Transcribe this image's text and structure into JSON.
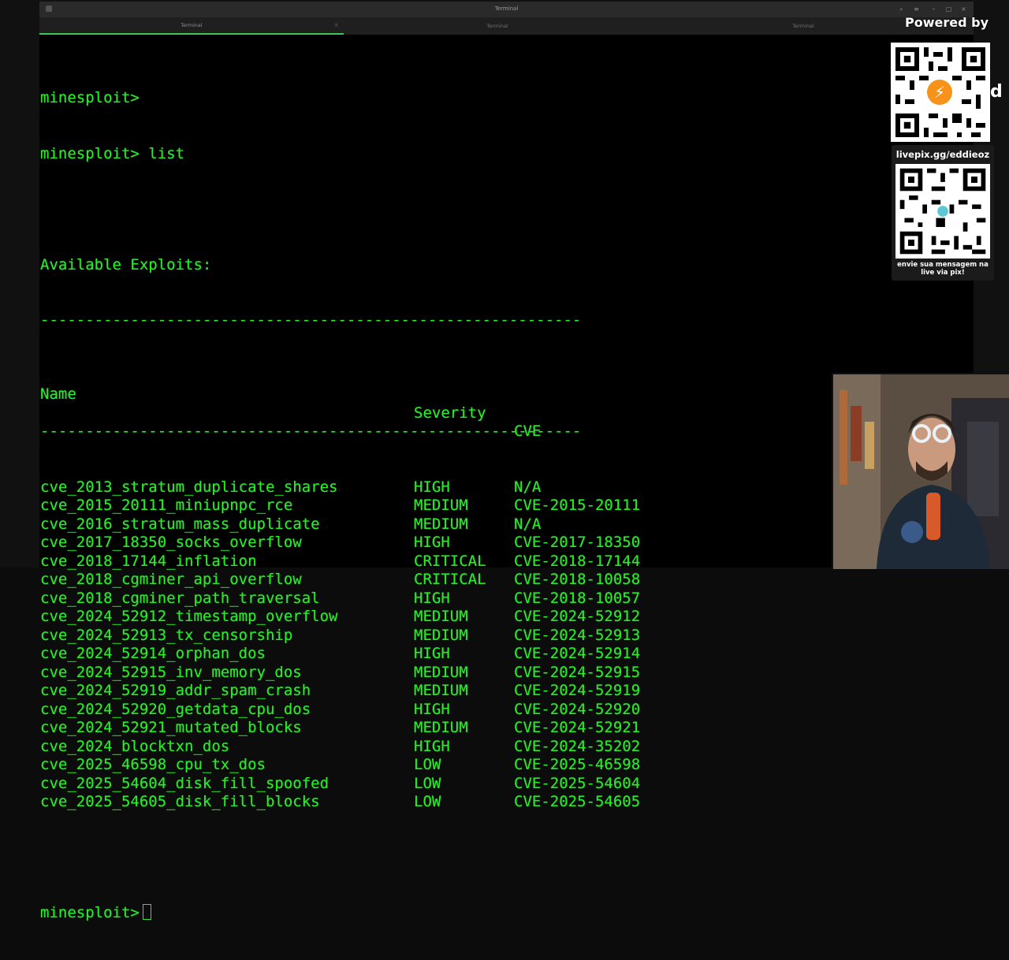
{
  "window": {
    "title": "Terminal",
    "tabs": [
      {
        "label": "Terminal",
        "active": true
      },
      {
        "label": "Terminal",
        "active": false
      },
      {
        "label": "Terminal",
        "active": false
      }
    ]
  },
  "terminal": {
    "prompt_line_1": "minesploit>",
    "prompt_line_2": "minesploit> list",
    "heading": "Available Exploits:",
    "separator": "------------------------------------------------------------",
    "columns": {
      "name": "Name",
      "severity": "Severity",
      "cve": "CVE"
    },
    "exploits": [
      {
        "name": "cve_2013_stratum_duplicate_shares",
        "severity": "HIGH",
        "cve": "N/A"
      },
      {
        "name": "cve_2015_20111_miniupnpc_rce",
        "severity": "MEDIUM",
        "cve": "CVE-2015-20111"
      },
      {
        "name": "cve_2016_stratum_mass_duplicate",
        "severity": "MEDIUM",
        "cve": "N/A"
      },
      {
        "name": "cve_2017_18350_socks_overflow",
        "severity": "HIGH",
        "cve": "CVE-2017-18350"
      },
      {
        "name": "cve_2018_17144_inflation",
        "severity": "CRITICAL",
        "cve": "CVE-2018-17144"
      },
      {
        "name": "cve_2018_cgminer_api_overflow",
        "severity": "CRITICAL",
        "cve": "CVE-2018-10058"
      },
      {
        "name": "cve_2018_cgminer_path_traversal",
        "severity": "HIGH",
        "cve": "CVE-2018-10057"
      },
      {
        "name": "cve_2024_52912_timestamp_overflow",
        "severity": "MEDIUM",
        "cve": "CVE-2024-52912"
      },
      {
        "name": "cve_2024_52913_tx_censorship",
        "severity": "MEDIUM",
        "cve": "CVE-2024-52913"
      },
      {
        "name": "cve_2024_52914_orphan_dos",
        "severity": "HIGH",
        "cve": "CVE-2024-52914"
      },
      {
        "name": "cve_2024_52915_inv_memory_dos",
        "severity": "MEDIUM",
        "cve": "CVE-2024-52915"
      },
      {
        "name": "cve_2024_52919_addr_spam_crash",
        "severity": "MEDIUM",
        "cve": "CVE-2024-52919"
      },
      {
        "name": "cve_2024_52920_getdata_cpu_dos",
        "severity": "HIGH",
        "cve": "CVE-2024-52920"
      },
      {
        "name": "cve_2024_52921_mutated_blocks",
        "severity": "MEDIUM",
        "cve": "CVE-2024-52921"
      },
      {
        "name": "cve_2024_blocktxn_dos",
        "severity": "HIGH",
        "cve": "CVE-2024-35202"
      },
      {
        "name": "cve_2025_46598_cpu_tx_dos",
        "severity": "LOW",
        "cve": "CVE-2025-46598"
      },
      {
        "name": "cve_2025_54604_disk_fill_spoofed",
        "severity": "LOW",
        "cve": "CVE-2025-54604"
      },
      {
        "name": "cve_2025_54605_disk_fill_blocks",
        "severity": "LOW",
        "cve": "CVE-2025-54605"
      }
    ],
    "final_prompt": "minesploit>"
  },
  "overlay": {
    "powered_by": "Powered by",
    "side_letter": "d",
    "qr_badge_icon": "lightning-bolt-icon",
    "livepix_url": "livepix.gg/eddieoz",
    "livepix_caption": "envie sua mensagem na live via pix!"
  },
  "colors": {
    "terminal_text": "#2aeb2a",
    "terminal_bg": "#000000",
    "tab_accent": "#3cc84c",
    "badge": "#f7931a"
  }
}
